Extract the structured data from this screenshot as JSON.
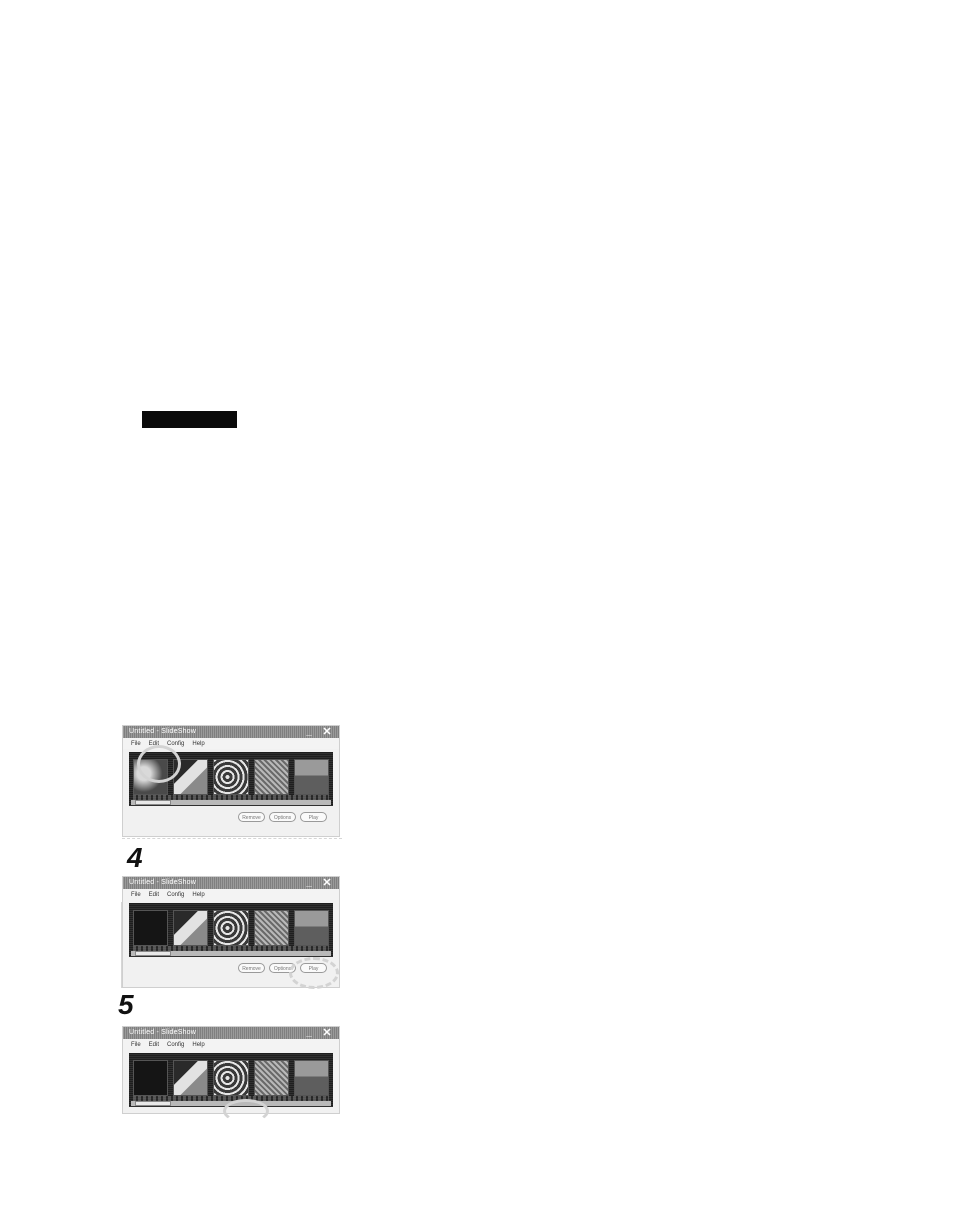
{
  "steps": [
    {
      "window_title": "Untitled - SlideShow",
      "menu": [
        "File",
        "Edit",
        "Config",
        "Help"
      ],
      "buttons": [
        "Remove",
        "Options",
        "Play"
      ]
    },
    {
      "number": "4",
      "window_title": "Untitled - SlideShow",
      "menu": [
        "File",
        "Edit",
        "Config",
        "Help"
      ],
      "buttons": [
        "Remove",
        "Options",
        "Play"
      ]
    },
    {
      "number": "5",
      "window_title": "Untitled - SlideShow",
      "menu": [
        "File",
        "Edit",
        "Config",
        "Help"
      ]
    }
  ],
  "colors": {
    "titlebar": "#8e8e8e",
    "film_strip": "#2b2b2b",
    "highlight_ring": "#d3d3d3",
    "redaction_bar": "#0a0a0a"
  }
}
